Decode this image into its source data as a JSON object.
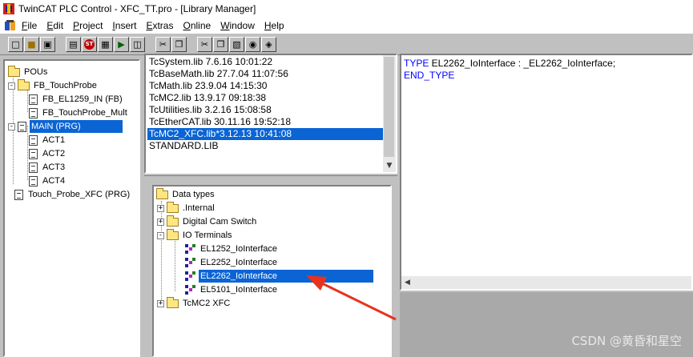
{
  "window": {
    "title": "TwinCAT PLC Control - XFC_TT.pro - [Library Manager]"
  },
  "menubar": {
    "items": [
      "File",
      "Edit",
      "Project",
      "Insert",
      "Extras",
      "Online",
      "Window",
      "Help"
    ]
  },
  "toolbar": {
    "buttons": [
      "new-icon",
      "open-icon",
      "save-icon",
      "compile-icon",
      "login-icon",
      "stop-icon",
      "logout-icon",
      "run-icon",
      "print-icon",
      "cut-icon",
      "copy-icon",
      "cut2-icon",
      "copy2-icon",
      "paste-icon",
      "find-icon",
      "replace-icon"
    ],
    "stop_label": "ST"
  },
  "pou_tree": {
    "root": "POUs",
    "items": [
      {
        "label": "FB_TouchProbe",
        "type": "folder"
      },
      {
        "label": "FB_EL1259_IN (FB)",
        "type": "pou"
      },
      {
        "label": "FB_TouchProbe_Mult",
        "type": "pou"
      },
      {
        "label": "MAIN (PRG)",
        "type": "pou",
        "selected": true
      },
      {
        "label": "ACT1",
        "type": "action"
      },
      {
        "label": "ACT2",
        "type": "action"
      },
      {
        "label": "ACT3",
        "type": "action"
      },
      {
        "label": "ACT4",
        "type": "action"
      },
      {
        "label": "Touch_Probe_XFC (PRG)",
        "type": "pou"
      }
    ]
  },
  "libraries": {
    "items": [
      "TcSystem.lib 7.6.16 10:01:22",
      "TcBaseMath.lib 27.7.04 11:07:56",
      "TcMath.lib 23.9.04 14:15:30",
      "TcMC2.lib 13.9.17 09:18:38",
      "TcUtilities.lib 3.2.16 15:08:58",
      "TcEtherCAT.lib 30.11.16 19:52:18",
      "TcMC2_XFC.lib*3.12.13 10:41:08",
      "STANDARD.LIB"
    ],
    "selected_index": 6
  },
  "data_types": {
    "root": "Data types",
    "items": [
      {
        "label": ".Internal",
        "type": "folder",
        "expander": "+"
      },
      {
        "label": "Digital Cam Switch",
        "type": "folder",
        "expander": "+"
      },
      {
        "label": "IO Terminals",
        "type": "folder",
        "expander": "-"
      },
      {
        "label": "EL1252_IoInterface",
        "type": "struct"
      },
      {
        "label": "EL2252_IoInterface",
        "type": "struct"
      },
      {
        "label": "EL2262_IoInterface",
        "type": "struct",
        "selected": true
      },
      {
        "label": "EL5101_IoInterface",
        "type": "struct"
      },
      {
        "label": "TcMC2 XFC",
        "type": "folder",
        "expander": "+"
      }
    ]
  },
  "declaration": {
    "kw_type": "TYPE",
    "type_name": " EL2262_IoInterface : _EL2262_IoInterface;",
    "kw_end": "END_TYPE"
  },
  "watermark": "CSDN @黄昏和星空",
  "colors": {
    "selection": "#0a64d4",
    "keyword": "#0000ff",
    "annotation_arrow": "#e8321e"
  }
}
